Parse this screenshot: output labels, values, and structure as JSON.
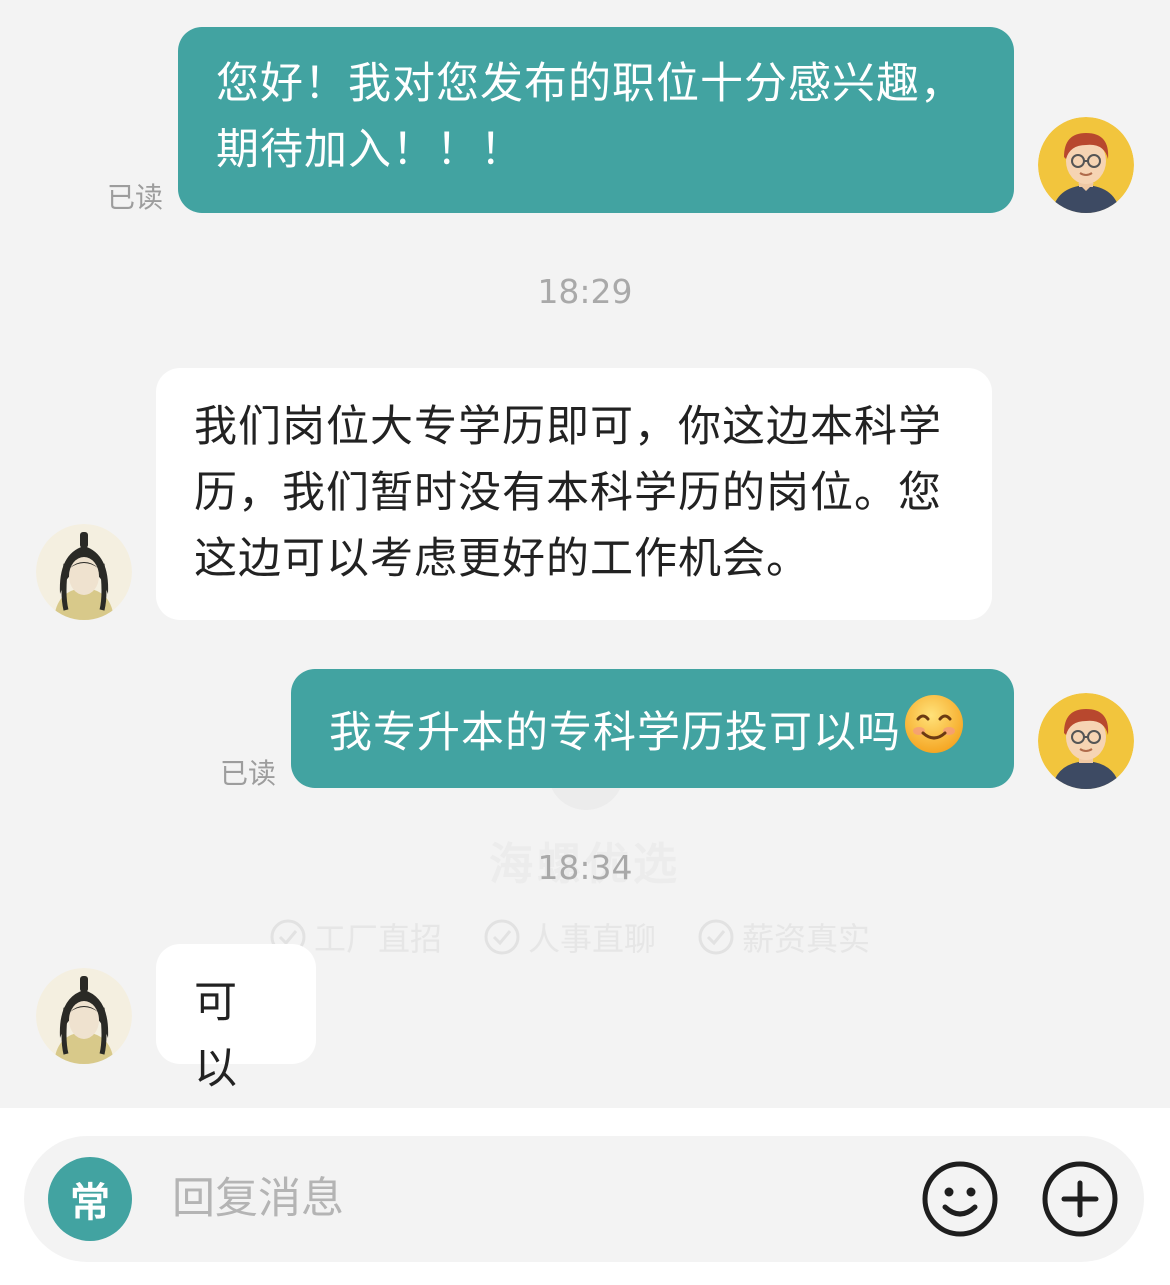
{
  "colors": {
    "accent": "#42a3a1",
    "background": "#f3f3f3",
    "incoming_bubble": "#ffffff"
  },
  "messages": [
    {
      "direction": "outgoing",
      "lines": [
        "您好！我对您发布的职位十分感兴趣，",
        "期待加入！！！"
      ],
      "status": "已读"
    },
    {
      "type": "timestamp",
      "text": "18:29"
    },
    {
      "direction": "incoming",
      "lines": [
        "我们岗位大专学历即可，你这边本科学",
        "历，我们暂时没有本科学历的岗位。您",
        "这边可以考虑更好的工作机会。"
      ]
    },
    {
      "direction": "outgoing",
      "lines": [
        "我专升本的专科学历投可以吗"
      ],
      "emoji": "smiling-face-emoji",
      "status": "已读"
    },
    {
      "type": "timestamp",
      "text": "18:34"
    },
    {
      "direction": "incoming",
      "lines": [
        "可以"
      ]
    }
  ],
  "watermark": {
    "title": "海螺优选",
    "tags": [
      "工厂直招",
      "人事直聊",
      "薪资真实"
    ]
  },
  "input_bar": {
    "quick_reply_label": "常",
    "placeholder": "回复消息",
    "emoji_icon": "smiley-icon",
    "plus_icon": "plus-circle-icon"
  }
}
